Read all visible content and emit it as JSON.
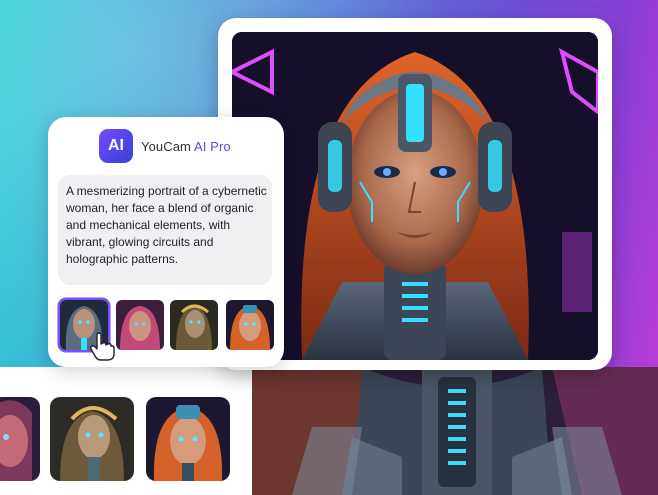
{
  "brand": {
    "logo_text": "AI",
    "name_prefix": "YouCam ",
    "name_suffix": "AI Pro",
    "accent_color": "#5a4ae3"
  },
  "prompt": {
    "text": "A mesmerizing portrait of a cybernetic woman, her face a blend of organic and mechanical elements, with vibrant, glowing circuits and holographic patterns."
  },
  "thumbnails": [
    {
      "icon": "cyborg-portrait-thumbnail",
      "selected": true
    },
    {
      "icon": "cyborg-portrait-thumbnail",
      "selected": false
    },
    {
      "icon": "cyborg-portrait-thumbnail",
      "selected": false
    },
    {
      "icon": "cyborg-portrait-thumbnail",
      "selected": false
    }
  ],
  "colors": {
    "neon_cyan": "#35e0ff",
    "neon_magenta": "#e14bff",
    "hair_orange": "#d8561f",
    "skin": "#c98a6a"
  }
}
